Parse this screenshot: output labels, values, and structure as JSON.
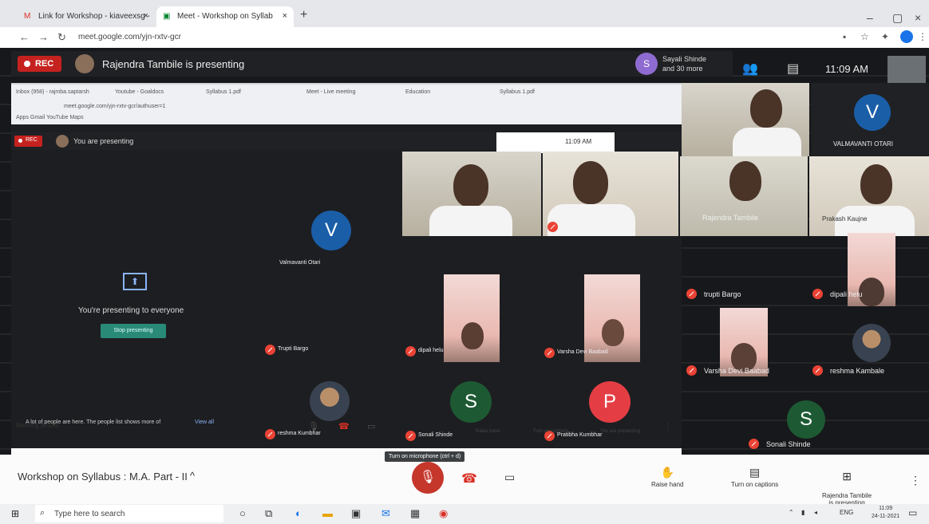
{
  "browser": {
    "tabs": [
      {
        "label": "Link for Workshop - kiaveexsg -",
        "favicon": "gmail-icon"
      },
      {
        "label": "Meet - Workshop on Syllab",
        "favicon": "meet-icon"
      }
    ],
    "url": "meet.google.com/yjn-rxtv-gcr",
    "window_controls": {
      "minimize": "–",
      "maximize": "▢",
      "close": "×"
    },
    "new_tab": "+"
  },
  "meet": {
    "rec_label": "REC",
    "presenting_text": "Rajendra Tambile is presenting",
    "speaker": {
      "initial": "S",
      "text": "Sayali Shinde\nand 30 more"
    },
    "clock": "11:09 AM"
  },
  "shared_screen": {
    "tabs": [
      "Inbox (958) - rajmba.saptarsh",
      "Youtube - Goaldocs",
      "Syllabus 1.pdf",
      "Meet - Live meeting",
      "Education",
      "Syllabus 1.pdf"
    ],
    "url": "meet.google.com/yjn-rxtv-gcr/authuser=1",
    "bookmarks": "Apps  Gmail  YouTube  Maps",
    "rec_label": "REC",
    "presenting_text": "You are presenting",
    "clock": "11:09 AM",
    "present_icon": "⬆",
    "present_message": "You're presenting to everyone",
    "stop_label": "Stop presenting",
    "join_text": "A lot of people are here. The people list shows more of",
    "view_all": "View all",
    "controls": {
      "meeting_details": "Meeting details",
      "raise_hand": "Raise hand",
      "captions": "Turn on captions",
      "presenting_tag": "You are presenting",
      "more": "⋮"
    }
  },
  "participants": [
    {
      "id": "v-large",
      "initial": "V",
      "name": "VALMAVANTI OTARI"
    },
    {
      "id": "v-inner",
      "initial": "V",
      "name": "Valmavanti Otari"
    },
    {
      "id": "p1",
      "name": "Rajendra Tambile"
    },
    {
      "id": "p2",
      "name": "Prakash Kaujne"
    },
    {
      "id": "p3",
      "name": "trupti Bargo"
    },
    {
      "id": "p4",
      "name": "dipali helu"
    },
    {
      "id": "p5",
      "name": "Varsha Devi Baabad"
    },
    {
      "id": "p6",
      "name": "reshma Kambale"
    },
    {
      "id": "p7",
      "name": "Sonali Shinde"
    },
    {
      "id": "s1",
      "initial": "S",
      "name": "Sonali Shinde"
    },
    {
      "id": "s2",
      "initial": "S",
      "name": "Sonali Shinde"
    },
    {
      "id": "pinit",
      "initial": "P",
      "name": "Pratibha Kumbhar"
    },
    {
      "id": "inner-names",
      "a": "Trupti Bargo",
      "b": "dipali helu",
      "c": "Varsha Devi Baabad",
      "d": "reshma Kumbhar"
    }
  ],
  "meetbar": {
    "title": "Workshop on Syllabus : M.A. Part - II",
    "chevron": "^",
    "tooltip": "Turn on microphone (ctrl + d)",
    "raise_hand": "Raise hand",
    "captions": "Turn on captions",
    "presenting": "Rajendra Tambile\nis presenting",
    "more": "⋮"
  },
  "taskbar": {
    "search_placeholder": "Type here to search",
    "tray_lang": "ENG",
    "time": "11:09",
    "date": "24-11-2021"
  }
}
